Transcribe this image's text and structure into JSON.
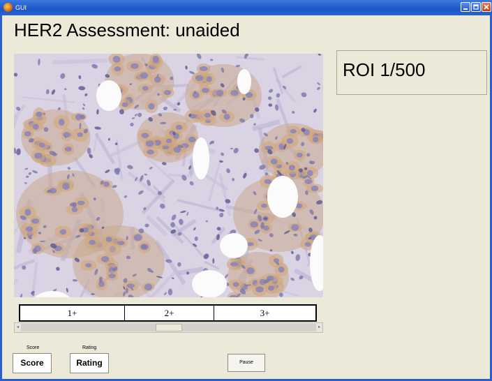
{
  "window": {
    "title": "GUI"
  },
  "heading": "HER2 Assessment: unaided",
  "roi_counter": "ROI 1/500",
  "score_scale": {
    "labels": [
      "1+",
      "2+",
      "3+"
    ]
  },
  "slider": {
    "left_arrow": "◂",
    "right_arrow": "▸",
    "position": 0.5
  },
  "score": {
    "caption": "Score",
    "button_label": "Score"
  },
  "rating": {
    "caption": "Rating",
    "button_label": "Rating"
  },
  "pause": {
    "button_label": "Pause"
  },
  "colors": {
    "titlebar": "#2a62d4",
    "panel": "#ece9d8",
    "stain_brown": "#c89a6e",
    "nuclei_blue": "#7b78ad"
  }
}
